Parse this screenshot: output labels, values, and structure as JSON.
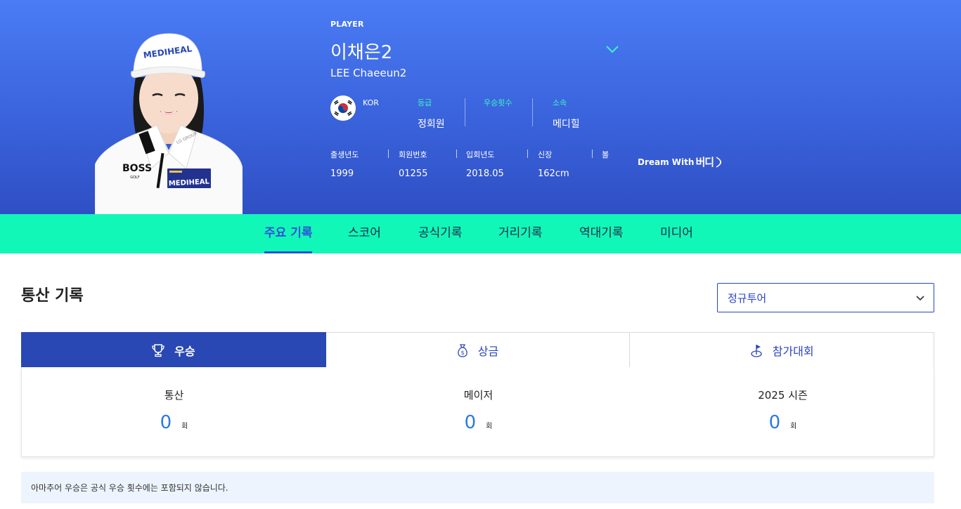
{
  "header": {
    "section_label": "PLAYER",
    "name_ko": "이채은2",
    "name_en": "LEE Chaeeun2",
    "nationality": "KOR",
    "info": [
      {
        "key": "등급",
        "value": "정회원"
      },
      {
        "key": "우승횟수",
        "value": ""
      },
      {
        "key": "소속",
        "value": "메디힐"
      }
    ],
    "stats": [
      {
        "key": "출생년도",
        "value": "1999"
      },
      {
        "key": "회원번호",
        "value": "01255"
      },
      {
        "key": "입회년도",
        "value": "2018.05"
      },
      {
        "key": "신장",
        "value": "162cm"
      },
      {
        "key": "볼",
        "value": ""
      }
    ],
    "sponsor": {
      "text": "Dream With",
      "mark": "버디"
    },
    "photo": {
      "cap_text": "MEDIHEAL",
      "shirt_brand": "BOSS",
      "shirt_brand_sub": "GOLF",
      "chest_text": "MEDIHEAL",
      "collar_text": "LG GROUP"
    }
  },
  "nav": {
    "tabs": [
      {
        "label": "주요 기록",
        "active": true
      },
      {
        "label": "스코어"
      },
      {
        "label": "공식기록"
      },
      {
        "label": "거리기록"
      },
      {
        "label": "역대기록"
      },
      {
        "label": "미디어"
      }
    ]
  },
  "records": {
    "title": "통산 기록",
    "tour_select": "정규투어",
    "tabs": [
      {
        "label": "우승",
        "icon": "trophy-icon",
        "active": true
      },
      {
        "label": "상금",
        "icon": "money-bag-icon"
      },
      {
        "label": "참가대회",
        "icon": "golf-flag-icon"
      }
    ],
    "cells": [
      {
        "label": "통산",
        "value": "0",
        "unit": "회"
      },
      {
        "label": "메이저",
        "value": "0",
        "unit": "회"
      },
      {
        "label": "2025 시즌",
        "value": "0",
        "unit": "회"
      }
    ],
    "notice": "아마추어 우승은 공식 우승 횟수에는 포함되지 않습니다."
  },
  "colors": {
    "hero_top": "#4a7cf5",
    "hero_bottom": "#2f4fc4",
    "nav_bg": "#11f7b7",
    "accent_blue": "#2a48b3",
    "value_blue": "#2a7ae2",
    "mint": "#3cf5c0"
  }
}
